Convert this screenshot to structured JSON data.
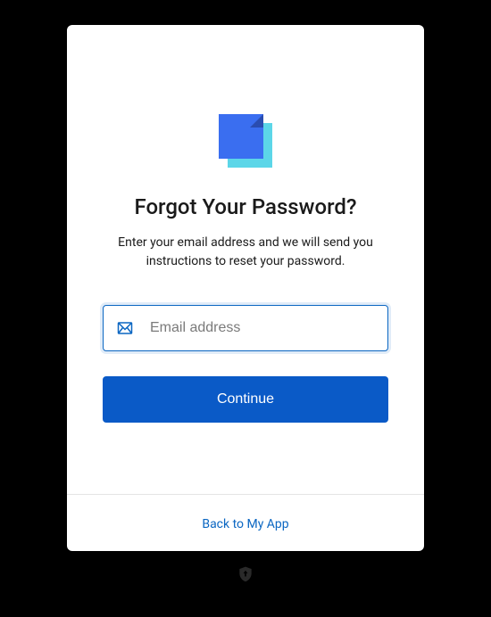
{
  "header": {
    "title": "Forgot Your Password?",
    "subtitle": "Enter your email address and we will send you instructions to reset your password."
  },
  "form": {
    "email_placeholder": "Email address",
    "email_value": "",
    "continue_label": "Continue"
  },
  "footer": {
    "back_link_label": "Back to My App"
  }
}
